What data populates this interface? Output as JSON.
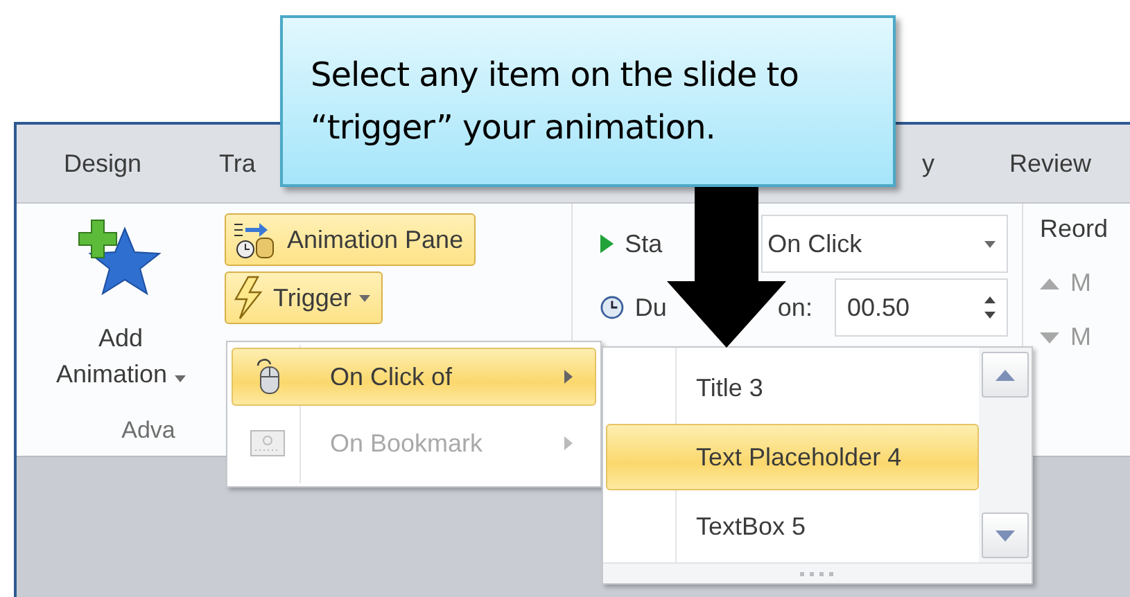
{
  "callout": {
    "text": "Select any item on the slide to “trigger” your animation."
  },
  "tabs": [
    {
      "label": "Design"
    },
    {
      "label": "Tra"
    },
    {
      "label": "y"
    },
    {
      "label": "Review"
    }
  ],
  "ribbon": {
    "add_animation": {
      "line1": "Add",
      "line2": "Animation",
      "group_label": "Adva"
    },
    "animation_pane": {
      "label": "Animation Pane"
    },
    "trigger": {
      "label": "Trigger"
    },
    "start": {
      "label": "Sta",
      "value": "On Click"
    },
    "duration": {
      "label_start": "Du",
      "label_end": "on:",
      "value": "00.50"
    },
    "reorder": {
      "label": "Reord",
      "move_earlier": "M",
      "move_later": "M"
    }
  },
  "trigger_menu": {
    "items": [
      {
        "label": "On Click of",
        "kind": "mouse",
        "selected": true,
        "disabled": false
      },
      {
        "label": "On Bookmark",
        "kind": "bookmark",
        "selected": false,
        "disabled": true
      }
    ]
  },
  "submenu": {
    "items": [
      {
        "label": "Title 3",
        "selected": false
      },
      {
        "label": "Text Placeholder 4",
        "selected": true
      },
      {
        "label": "TextBox 5",
        "selected": false
      }
    ]
  }
}
